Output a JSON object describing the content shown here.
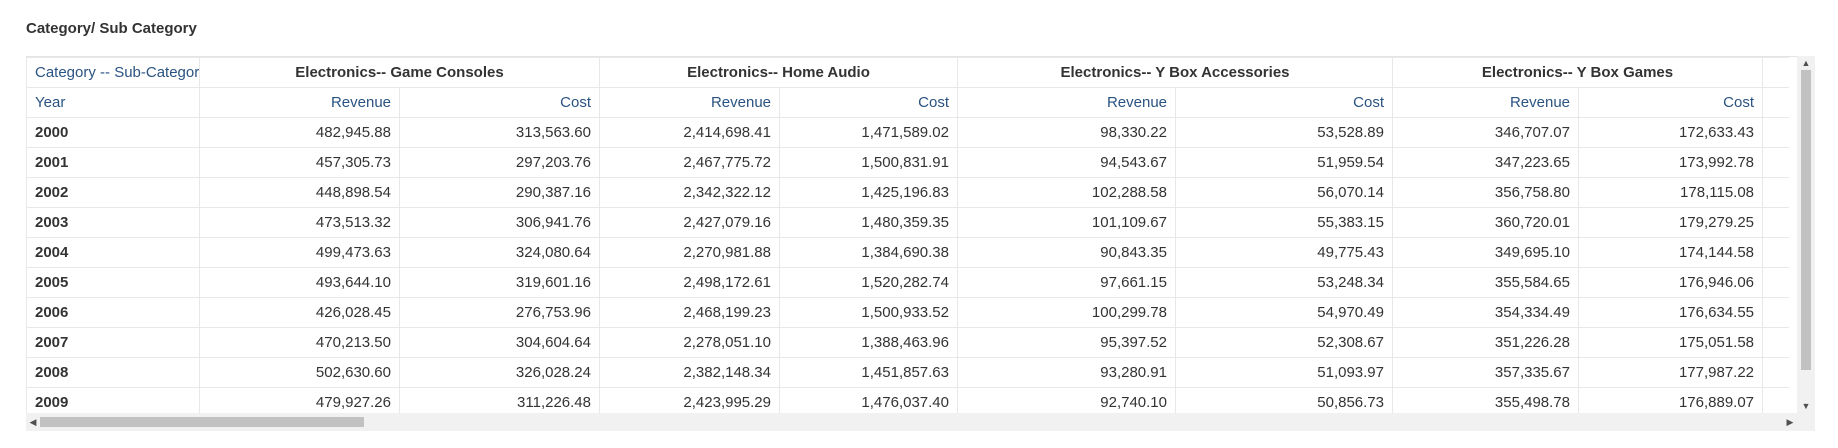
{
  "panel": {
    "title": "Category/ Sub Category"
  },
  "table": {
    "corner_label": "Category -- Sub-Category",
    "year_label": "Year",
    "groups": [
      {
        "label": "Electronics-- Game Consoles",
        "revenue": "Revenue",
        "cost": "Cost"
      },
      {
        "label": "Electronics-- Home Audio",
        "revenue": "Revenue",
        "cost": "Cost"
      },
      {
        "label": "Electronics-- Y Box Accessories",
        "revenue": "Revenue",
        "cost": "Cost"
      },
      {
        "label": "Electronics-- Y Box Games",
        "revenue": "Revenue",
        "cost": "Cost"
      }
    ],
    "rows": [
      {
        "year": "2000",
        "values": [
          "482,945.88",
          "313,563.60",
          "2,414,698.41",
          "1,471,589.02",
          "98,330.22",
          "53,528.89",
          "346,707.07",
          "172,633.43"
        ]
      },
      {
        "year": "2001",
        "values": [
          "457,305.73",
          "297,203.76",
          "2,467,775.72",
          "1,500,831.91",
          "94,543.67",
          "51,959.54",
          "347,223.65",
          "173,992.78"
        ]
      },
      {
        "year": "2002",
        "values": [
          "448,898.54",
          "290,387.16",
          "2,342,322.12",
          "1,425,196.83",
          "102,288.58",
          "56,070.14",
          "356,758.80",
          "178,115.08"
        ]
      },
      {
        "year": "2003",
        "values": [
          "473,513.32",
          "306,941.76",
          "2,427,079.16",
          "1,480,359.35",
          "101,109.67",
          "55,383.15",
          "360,720.01",
          "179,279.25"
        ]
      },
      {
        "year": "2004",
        "values": [
          "499,473.63",
          "324,080.64",
          "2,270,981.88",
          "1,384,690.38",
          "90,843.35",
          "49,775.43",
          "349,695.10",
          "174,144.58"
        ]
      },
      {
        "year": "2005",
        "values": [
          "493,644.10",
          "319,601.16",
          "2,498,172.61",
          "1,520,282.74",
          "97,661.15",
          "53,248.34",
          "355,584.65",
          "176,946.06"
        ]
      },
      {
        "year": "2006",
        "values": [
          "426,028.45",
          "276,753.96",
          "2,468,199.23",
          "1,500,933.52",
          "100,299.78",
          "54,970.49",
          "354,334.49",
          "176,634.55"
        ]
      },
      {
        "year": "2007",
        "values": [
          "470,213.50",
          "304,604.64",
          "2,278,051.10",
          "1,388,463.96",
          "95,397.52",
          "52,308.67",
          "351,226.28",
          "175,051.58"
        ]
      },
      {
        "year": "2008",
        "values": [
          "502,630.60",
          "326,028.24",
          "2,382,148.34",
          "1,451,857.63",
          "93,280.91",
          "51,093.97",
          "357,335.67",
          "177,987.22"
        ]
      },
      {
        "year": "2009",
        "values": [
          "479,927.26",
          "311,226.48",
          "2,423,995.29",
          "1,476,037.40",
          "92,740.10",
          "50,856.73",
          "355,498.78",
          "176,889.07"
        ]
      }
    ]
  }
}
